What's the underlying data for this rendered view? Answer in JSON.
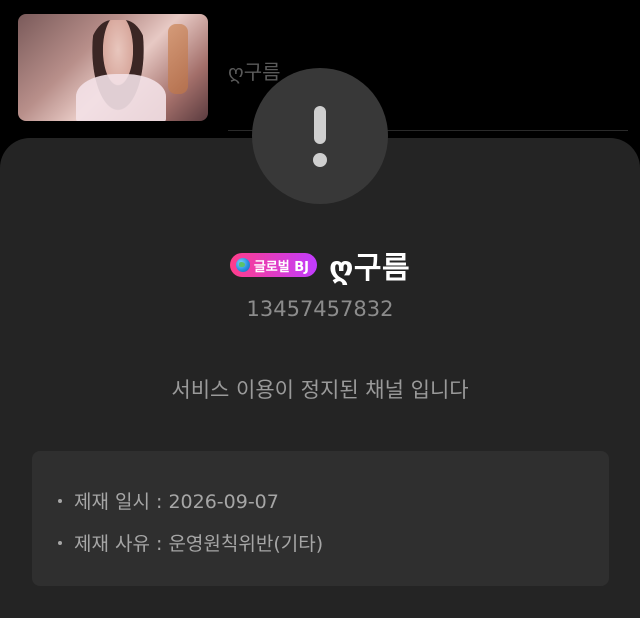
{
  "background_list": {
    "item": {
      "name": "ღ구름"
    }
  },
  "modal": {
    "icon": "exclamation-icon",
    "badge": {
      "icon": "globe-icon",
      "label": "글로벌 BJ"
    },
    "channel_name": "ღ구름",
    "channel_id": "13457457832",
    "notice": "서비스 이용이 정지된 채널 입니다",
    "details": [
      {
        "label": "제재 일시 : 2026-09-07"
      },
      {
        "label": "제재 사유 : 운영원칙위반(기타)"
      }
    ]
  },
  "colors": {
    "sheet_bg": "#242424",
    "info_box_bg": "#2f2f2f",
    "badge_gradient_start": "#ff3d8a",
    "badge_gradient_end": "#c13cff"
  }
}
